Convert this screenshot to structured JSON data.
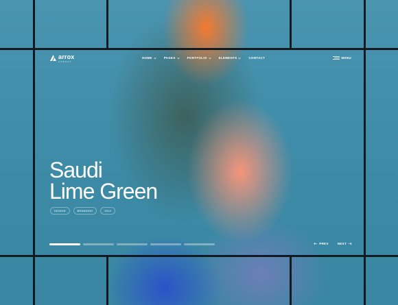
{
  "header": {
    "logo_text": "arrox",
    "logo_subtext": "AGENCY",
    "menu_label": "MENU"
  },
  "nav": {
    "items": [
      {
        "label": "HOME"
      },
      {
        "label": "PAGES"
      },
      {
        "label": "PORTFOLIO"
      },
      {
        "label": "ELEMENTS"
      },
      {
        "label": "CONTACT"
      }
    ]
  },
  "hero": {
    "title_line1": "Saudi",
    "title_line2": "Lime Green",
    "tags": [
      "DESIGN",
      "BRANDING",
      "2014"
    ]
  },
  "slider": {
    "active_index": 0,
    "prev_label": "PREV",
    "next_label": "NEXT"
  },
  "colors": {
    "background": "#3c8aa6",
    "frame": "#121a1f",
    "text": "#ffffff"
  }
}
